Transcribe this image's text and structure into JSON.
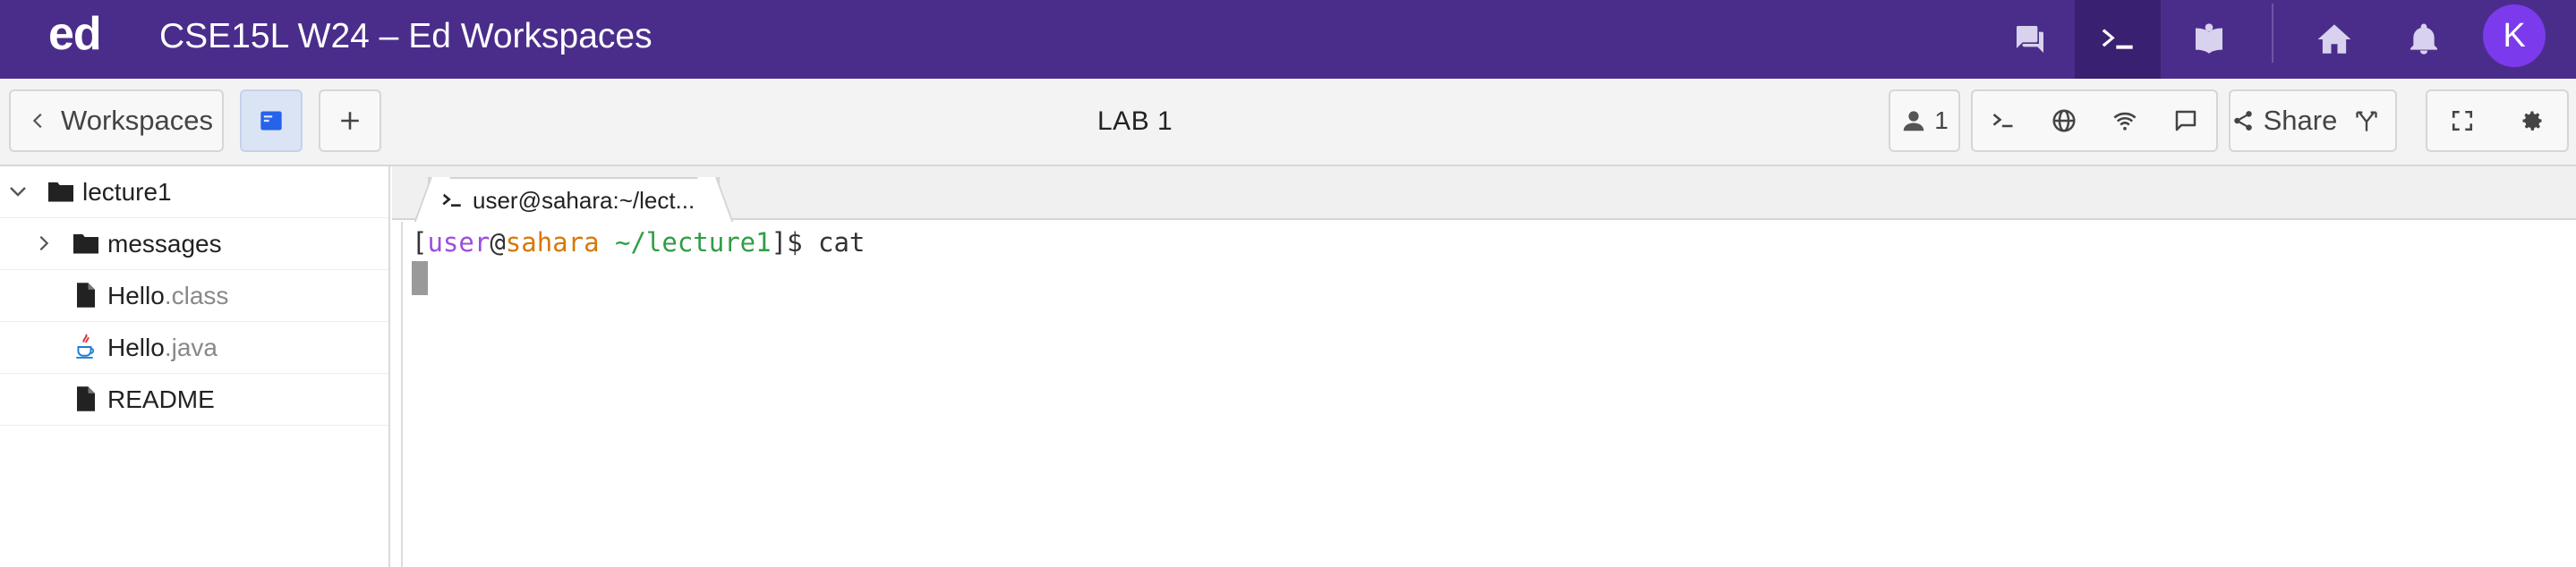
{
  "header": {
    "logo": "ed",
    "title": "CSE15L W24 – Ed Workspaces",
    "icons": [
      "discussion-icon",
      "terminal-icon",
      "lessons-icon",
      "home-icon",
      "bell-icon"
    ],
    "avatar_initial": "K"
  },
  "toolbar": {
    "workspaces_label": "Workspaces",
    "lab_title": "LAB 1",
    "users_count": "1",
    "share_label": "Share"
  },
  "sidebar": {
    "items": [
      {
        "name": "lecture1",
        "ext": "",
        "type": "folder",
        "expanded": true
      },
      {
        "name": "messages",
        "ext": "",
        "type": "folder",
        "expanded": false
      },
      {
        "name": "Hello",
        "ext": ".class",
        "type": "file"
      },
      {
        "name": "Hello",
        "ext": ".java",
        "type": "java-file"
      },
      {
        "name": "README",
        "ext": "",
        "type": "file"
      }
    ]
  },
  "terminal": {
    "tab_label": "user@sahara:~/lect...",
    "prompt_open": "[",
    "user": "user",
    "at": "@",
    "host": "sahara",
    "path": " ~/lecture1",
    "prompt_close": "]$ ",
    "command": "cat"
  },
  "colors": {
    "header_bg": "#4a2d8b",
    "accent_avatar": "#7c3aed",
    "active_blue": "#2563eb",
    "prompt_user": "#9d4edd",
    "prompt_host": "#d97706",
    "prompt_path": "#2f9e44"
  }
}
